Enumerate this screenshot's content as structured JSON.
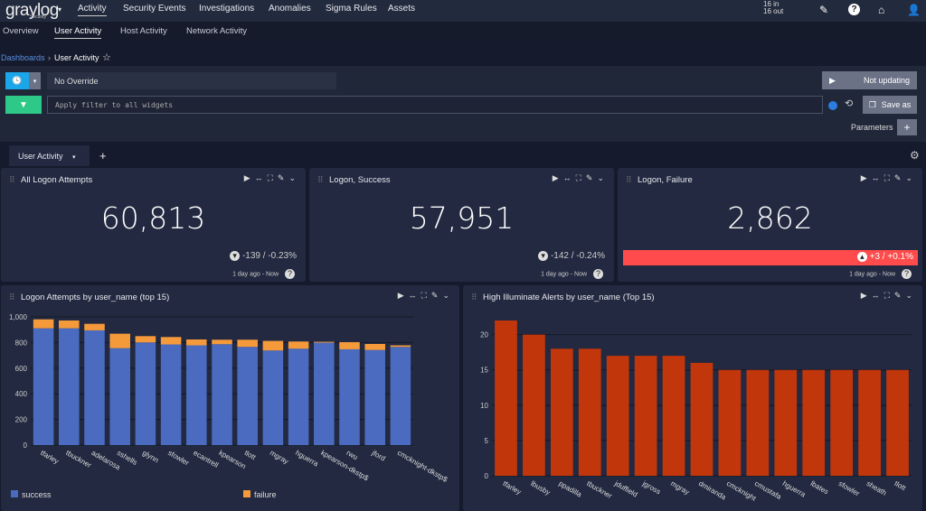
{
  "nav": {
    "brand": "graylog",
    "brand_sub": "Security",
    "items": [
      "Activity",
      "Security Events",
      "Investigations",
      "Anomalies",
      "Sigma Rules",
      "Assets"
    ],
    "active": "Activity",
    "throughput_in": "16 in",
    "throughput_out": "16 out",
    "icons": [
      "edit-icon",
      "help-icon",
      "home-icon",
      "user-icon"
    ]
  },
  "subnav": {
    "items": [
      "Overview",
      "User Activity",
      "Host Activity",
      "Network Activity"
    ],
    "active": "User Activity"
  },
  "breadcrumb": {
    "parent": "Dashboards",
    "current": "User Activity"
  },
  "search": {
    "timerange": "No Override",
    "filter_placeholder": "Apply filter to all widgets",
    "refresh": "Not updating",
    "save_as": "Save as",
    "parameters": "Parameters"
  },
  "tabs": {
    "items": [
      "User Activity"
    ]
  },
  "colors": {
    "success": "#4a6bbf",
    "failure": "#f59a3b",
    "alerts": "#c1360b",
    "negative": "#ff4b4b",
    "time_button": "#1aa6e8",
    "filter_button": "#2ec988"
  },
  "widgets": {
    "all": {
      "title": "All Logon Attempts",
      "value": "60,813",
      "delta": "-139 / -0.23%",
      "range": "1 day ago - Now"
    },
    "success": {
      "title": "Logon, Success",
      "value": "57,951",
      "delta": "-142 / -0.24%",
      "range": "1 day ago - Now"
    },
    "failure": {
      "title": "Logon, Failure",
      "value": "2,862",
      "delta": "+3 / +0.1%",
      "range": "1 day ago - Now"
    },
    "attempts": {
      "title": "Logon Attempts by user_name (top 15)"
    },
    "alerts": {
      "title": "High Illuminate Alerts by user_name (Top 15)"
    }
  },
  "chart_data": [
    {
      "type": "bar",
      "stacked": true,
      "categories": [
        "tfarley",
        "tbuckner",
        "adelarosa",
        "sshells",
        "glynn",
        "sfowler",
        "ecantrell",
        "kpearson",
        "tlott",
        "mgray",
        "hguerra",
        "kpearson-dkstp$",
        "rwu",
        "jford",
        "cmcknight-dkstp$"
      ],
      "series": [
        {
          "name": "success",
          "values": [
            911,
            911,
            895,
            756,
            801,
            785,
            778,
            787,
            766,
            738,
            752,
            799,
            747,
            742,
            766
          ]
        },
        {
          "name": "failure",
          "values": [
            70,
            61,
            51,
            113,
            49,
            58,
            46,
            35,
            56,
            75,
            56,
            7,
            56,
            47,
            12
          ]
        }
      ],
      "ylim": [
        0,
        1000
      ],
      "yticks": [
        "0",
        "200",
        "400",
        "600",
        "800",
        "1,000"
      ],
      "grid": true,
      "legend": "bottom"
    },
    {
      "type": "bar",
      "categories": [
        "tfarley",
        "lbusby",
        "ppadilla",
        "tbuckner",
        "jduffield",
        "jgross",
        "mgray",
        "dmiranda",
        "cmcknight",
        "cmustafa",
        "hguerra",
        "lbates",
        "sfowler",
        "sheath",
        "tlott"
      ],
      "values": [
        22,
        20,
        18,
        18,
        17,
        17,
        17,
        16,
        15,
        15,
        15,
        15,
        15,
        15,
        15
      ],
      "ylim": [
        0,
        22
      ],
      "yticks": [
        "0",
        "5",
        "10",
        "15",
        "20"
      ],
      "grid": true
    }
  ]
}
